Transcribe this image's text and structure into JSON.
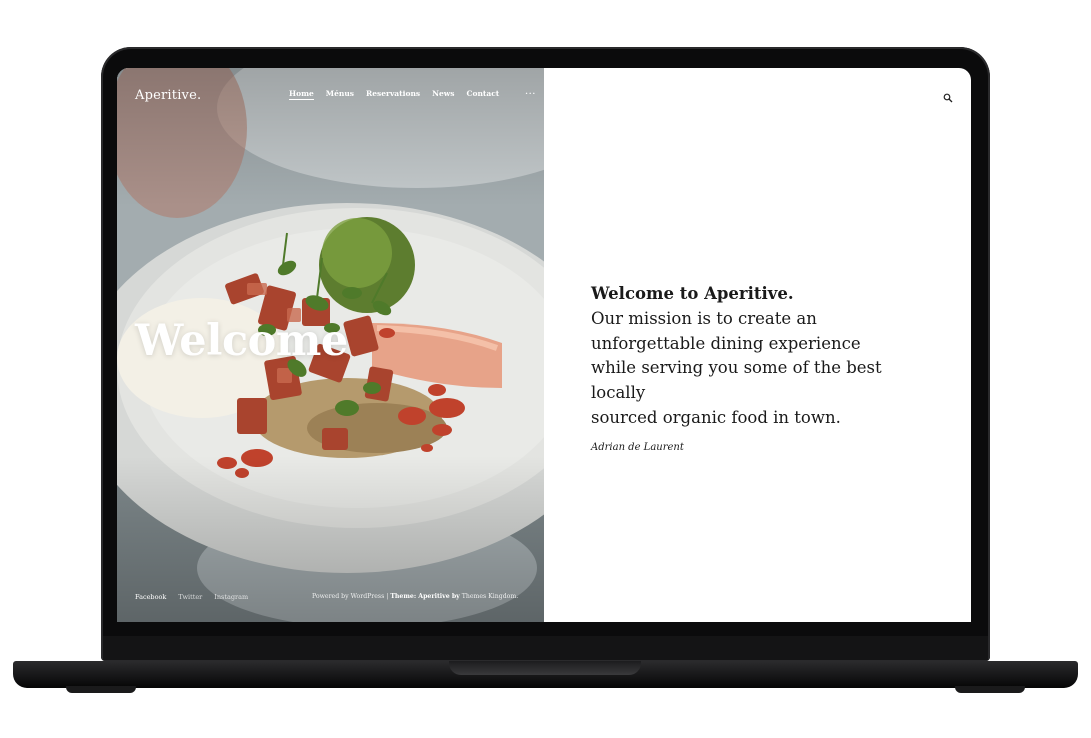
{
  "site": {
    "logo": "Aperitive."
  },
  "nav": {
    "items": [
      {
        "label": "Home"
      },
      {
        "label": "Ménus"
      },
      {
        "label": "Reservations"
      },
      {
        "label": "News"
      },
      {
        "label": "Contact"
      }
    ],
    "more_label": "···",
    "active_index": 0
  },
  "hero": {
    "heading": "Welcome"
  },
  "footer": {
    "social": [
      "Facebook",
      "Twitter",
      "Instagram"
    ],
    "credits_prefix": "Powered by WordPress | ",
    "credits_theme_label": "Theme: Aperitive by",
    "credits_author": " Themes Kingdom."
  },
  "intro": {
    "title": "Welcome to Aperitive.",
    "lines": [
      "Our mission is to create an",
      "unforgettable dining experience",
      "while serving you some of the best locally",
      "sourced organic food in town."
    ],
    "signature": "Adrian de Laurent"
  },
  "icons": {
    "search": "search-icon",
    "more": "more-icon"
  },
  "colors": {
    "text_dark": "#1a1a1a",
    "hero_text": "#ffffff",
    "device": "#0b0b0c"
  }
}
